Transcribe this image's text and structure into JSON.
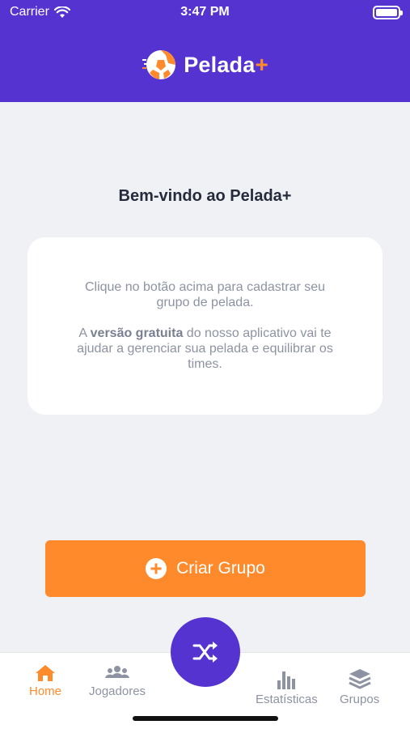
{
  "status_bar": {
    "carrier": "Carrier",
    "time": "3:47 PM"
  },
  "header": {
    "app_name": "Pelada",
    "app_plus": "+"
  },
  "main": {
    "welcome_title": "Bem-vindo ao Pelada+",
    "card": {
      "paragraph1": "Clique no botão acima para cadastrar seu grupo de pelada.",
      "paragraph2_prefix": "A ",
      "paragraph2_bold": "versão gratuita",
      "paragraph2_suffix": " do nosso aplicativo vai te ajudar a gerenciar sua pelada e equilibrar os times."
    },
    "create_button_label": "Criar Grupo"
  },
  "tab_bar": {
    "items": [
      {
        "label": "Home",
        "icon": "home-icon",
        "active": true
      },
      {
        "label": "Jogadores",
        "icon": "users-icon",
        "active": false
      },
      {
        "label": "Estatísticas",
        "icon": "bar-chart-icon",
        "active": false
      },
      {
        "label": "Grupos",
        "icon": "layers-icon",
        "active": false
      }
    ],
    "center_action_icon": "shuffle-icon"
  },
  "colors": {
    "brand_purple": "#5433d1",
    "accent_orange": "#ff8a2b"
  }
}
